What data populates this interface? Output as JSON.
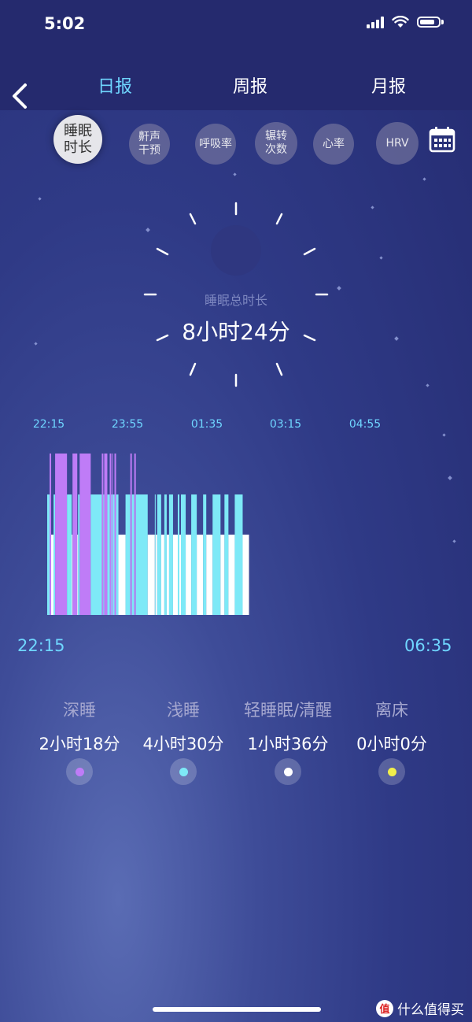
{
  "status_bar": {
    "time": "5:02"
  },
  "nav": {
    "period_tabs": [
      {
        "label": "日报",
        "active": true
      },
      {
        "label": "周报",
        "active": false
      },
      {
        "label": "月报",
        "active": false
      }
    ]
  },
  "metrics": [
    {
      "label": "睡眠\n时长",
      "active": true
    },
    {
      "label": "鼾声\n干预",
      "active": false
    },
    {
      "label": "呼吸率",
      "active": false
    },
    {
      "label": "辗转\n次数",
      "active": false
    },
    {
      "label": "心率",
      "active": false
    },
    {
      "label": "HRV",
      "active": false
    }
  ],
  "summary": {
    "label": "睡眠总时长",
    "value": "8小时24分"
  },
  "chart_data": {
    "type": "bar",
    "tick_labels": [
      "22:15",
      "23:55",
      "01:35",
      "03:15",
      "04:55"
    ],
    "x_start": "22:15",
    "x_end": "06:35",
    "levels": {
      "deep": 3,
      "light": 2,
      "awake": 1
    },
    "colors": {
      "deep": "#bf7cf7",
      "light": "#7ee9f7",
      "awake": "#ffffff"
    },
    "segments": [
      [
        "22:15",
        "22:18",
        "light"
      ],
      [
        "22:18",
        "22:20",
        "deep"
      ],
      [
        "22:20",
        "22:23",
        "awake"
      ],
      [
        "22:23",
        "22:25",
        "light"
      ],
      [
        "22:25",
        "22:40",
        "deep"
      ],
      [
        "22:40",
        "22:46",
        "light"
      ],
      [
        "22:46",
        "22:47",
        "awake"
      ],
      [
        "22:47",
        "22:53",
        "deep"
      ],
      [
        "22:53",
        "22:54",
        "awake"
      ],
      [
        "22:54",
        "22:56",
        "light"
      ],
      [
        "22:56",
        "23:10",
        "deep"
      ],
      [
        "23:10",
        "23:24",
        "light"
      ],
      [
        "23:24",
        "23:26",
        "deep"
      ],
      [
        "23:26",
        "23:27",
        "light"
      ],
      [
        "23:27",
        "23:31",
        "deep"
      ],
      [
        "23:31",
        "23:34",
        "light"
      ],
      [
        "23:34",
        "23:36",
        "deep"
      ],
      [
        "23:36",
        "23:37",
        "light"
      ],
      [
        "23:37",
        "23:38",
        "deep"
      ],
      [
        "23:38",
        "23:40",
        "light"
      ],
      [
        "23:40",
        "23:42",
        "deep"
      ],
      [
        "23:42",
        "23:45",
        "light"
      ],
      [
        "23:45",
        "23:54",
        "awake"
      ],
      [
        "23:54",
        "00:00",
        "light"
      ],
      [
        "00:00",
        "00:02",
        "deep"
      ],
      [
        "00:02",
        "00:05",
        "light"
      ],
      [
        "00:05",
        "00:07",
        "deep"
      ],
      [
        "00:07",
        "00:22",
        "light"
      ],
      [
        "00:22",
        "00:31",
        "awake"
      ],
      [
        "00:31",
        "00:32",
        "light"
      ],
      [
        "00:32",
        "00:34",
        "awake"
      ],
      [
        "00:34",
        "00:39",
        "light"
      ],
      [
        "00:39",
        "00:43",
        "awake"
      ],
      [
        "00:43",
        "00:46",
        "light"
      ],
      [
        "00:46",
        "00:49",
        "awake"
      ],
      [
        "00:49",
        "00:54",
        "light"
      ],
      [
        "00:54",
        "01:00",
        "awake"
      ],
      [
        "01:00",
        "01:02",
        "light"
      ],
      [
        "01:02",
        "01:04",
        "awake"
      ],
      [
        "01:04",
        "01:10",
        "light"
      ],
      [
        "01:10",
        "01:17",
        "awake"
      ],
      [
        "01:17",
        "01:24",
        "light"
      ],
      [
        "01:24",
        "01:32",
        "awake"
      ],
      [
        "01:32",
        "01:36",
        "light"
      ],
      [
        "01:36",
        "01:44",
        "awake"
      ],
      [
        "01:44",
        "01:54",
        "light"
      ],
      [
        "01:54",
        "01:59",
        "awake"
      ],
      [
        "01:59",
        "02:04",
        "light"
      ],
      [
        "02:04",
        "02:12",
        "awake"
      ],
      [
        "02:12",
        "02:22",
        "light"
      ],
      [
        "02:22",
        "02:30",
        "awake"
      ]
    ]
  },
  "legend": [
    {
      "name": "深睡",
      "value": "2小时18分",
      "color": "#bf7cf7"
    },
    {
      "name": "浅睡",
      "value": "4小时30分",
      "color": "#7ee9f7"
    },
    {
      "name": "轻睡眠/清醒",
      "value": "1小时36分",
      "color": "#ffffff"
    },
    {
      "name": "离床",
      "value": "0小时0分",
      "color": "#f2ef4a"
    }
  ],
  "watermark": {
    "text": "什么值得买",
    "logo": "值"
  }
}
